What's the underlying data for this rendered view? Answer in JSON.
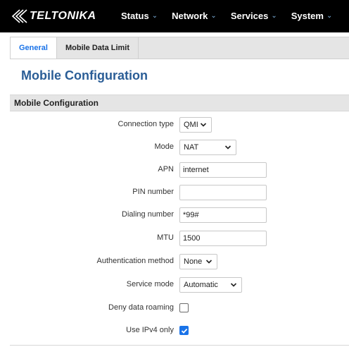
{
  "brand": {
    "name": "TELTONIKA"
  },
  "nav": [
    {
      "label": "Status"
    },
    {
      "label": "Network"
    },
    {
      "label": "Services"
    },
    {
      "label": "System"
    }
  ],
  "tabs": [
    {
      "label": "General",
      "active": true
    },
    {
      "label": "Mobile Data Limit",
      "active": false
    }
  ],
  "page_title": "Mobile Configuration",
  "section_title": "Mobile Configuration",
  "fields": {
    "connection_type": {
      "label": "Connection type",
      "value": "QMI"
    },
    "mode": {
      "label": "Mode",
      "value": "NAT"
    },
    "apn": {
      "label": "APN",
      "value": "internet"
    },
    "pin": {
      "label": "PIN number",
      "value": ""
    },
    "dialing": {
      "label": "Dialing number",
      "value": "*99#"
    },
    "mtu": {
      "label": "MTU",
      "value": "1500"
    },
    "auth": {
      "label": "Authentication method",
      "value": "None"
    },
    "service_mode": {
      "label": "Service mode",
      "value": "Automatic"
    },
    "deny_roaming": {
      "label": "Deny data roaming",
      "checked": false
    },
    "ipv4_only": {
      "label": "Use IPv4 only",
      "checked": true
    }
  },
  "colors": {
    "accent": "#1a73e8",
    "title": "#2a5d96",
    "topbar": "#000000"
  }
}
